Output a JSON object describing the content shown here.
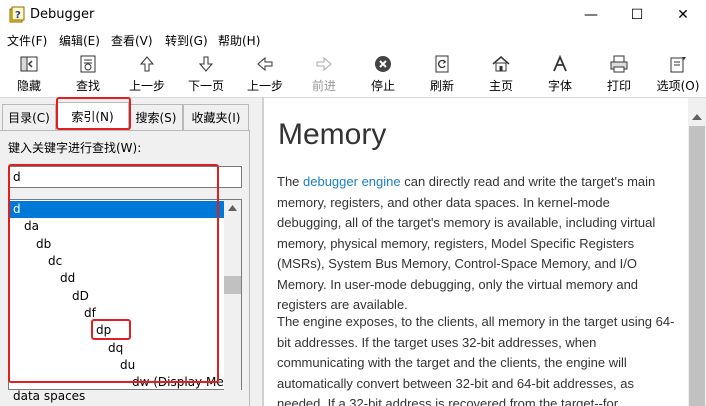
{
  "window": {
    "title": "Debugger",
    "minimize": "—",
    "maximize": "☐",
    "close": "✕"
  },
  "menu": [
    "文件(F)",
    "编辑(E)",
    "查看(V)",
    "转到(G)",
    "帮助(H)"
  ],
  "toolbar": {
    "hide": "隐藏",
    "find": "查找",
    "prev_step": "上一步",
    "next_page": "下一页",
    "back": "上一步",
    "forward": "前进",
    "stop": "停止",
    "refresh": "刷新",
    "home": "主页",
    "font": "字体",
    "print": "打印",
    "options": "选项(O)"
  },
  "tabs": {
    "contents": "目录(C)",
    "index": "索引(N)",
    "search": "搜索(S)",
    "favorites": "收藏夹(I)"
  },
  "index": {
    "keyword_label": "键入关键字进行查找(W):",
    "keyword_value": "d",
    "items": [
      "d",
      "da",
      "db",
      "dc",
      "dd",
      "dD",
      "df",
      "dp",
      "dq",
      "du",
      "dw (Display Me"
    ],
    "selected": "d",
    "below_item": "data spaces"
  },
  "content": {
    "title": "Memory",
    "p1_pre": "The ",
    "p1_link": "debugger engine",
    "p1_post": " can directly read and write the target's main memory, registers, and other data spaces. In kernel-mode debugging, all of the target's memory is available, including virtual memory, physical memory, registers, Model Specific Registers (MSRs), System Bus Memory, Control-Space Memory, and I/O Memory. In user-mode debugging, only the virtual memory and registers are available.",
    "p2": "The engine exposes, to the clients, all memory in the target using 64-bit addresses. If the target uses 32-bit addresses, when communicating with the target and the clients, the engine will automatically convert between 32-bit and 64-bit addresses, as needed. If a 32-bit address is recovered from the target--for"
  }
}
